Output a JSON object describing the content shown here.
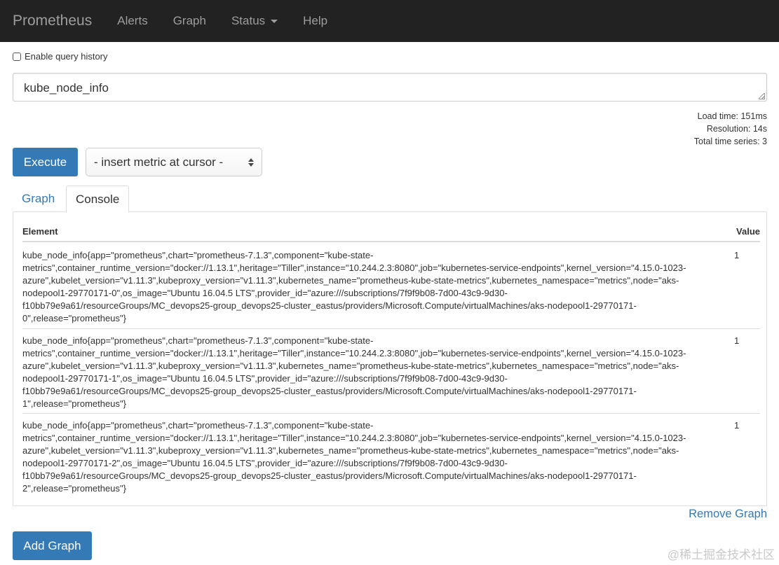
{
  "navbar": {
    "brand": "Prometheus",
    "items": [
      "Alerts",
      "Graph",
      "Status",
      "Help"
    ]
  },
  "history": {
    "label": "Enable query history",
    "checked": false
  },
  "query": {
    "value": "kube_node_info"
  },
  "stats": {
    "load_time": "Load time: 151ms",
    "resolution": "Resolution: 14s",
    "total_series": "Total time series: 3"
  },
  "execute_label": "Execute",
  "metric_select": {
    "selected": "- insert metric at cursor -"
  },
  "tabs": [
    {
      "label": "Graph",
      "active": false
    },
    {
      "label": "Console",
      "active": true
    }
  ],
  "table": {
    "headers": {
      "element": "Element",
      "value": "Value"
    },
    "rows": [
      {
        "element": "kube_node_info{app=\"prometheus\",chart=\"prometheus-7.1.3\",component=\"kube-state-\nmetrics\",container_runtime_version=\"docker://1.13.1\",heritage=\"Tiller\",instance=\"10.244.2.3:8080\",job=\"kubernetes-service-endpoints\",kernel_version=\"4.15.0-1023-\nazure\",kubelet_version=\"v1.11.3\",kubeproxy_version=\"v1.11.3\",kubernetes_name=\"prometheus-kube-state-metrics\",kubernetes_namespace=\"metrics\",node=\"aks-\nnodepool1-29770171-0\",os_image=\"Ubuntu 16.04.5 LTS\",provider_id=\"azure:///subscriptions/7f9f9b08-7d00-43c9-9d30-\nf10bb79e9a61/resourceGroups/MC_devops25-group_devops25-cluster_eastus/providers/Microsoft.Compute/virtualMachines/aks-nodepool1-29770171-\n0\",release=\"prometheus\"}",
        "value": "1"
      },
      {
        "element": "kube_node_info{app=\"prometheus\",chart=\"prometheus-7.1.3\",component=\"kube-state-\nmetrics\",container_runtime_version=\"docker://1.13.1\",heritage=\"Tiller\",instance=\"10.244.2.3:8080\",job=\"kubernetes-service-endpoints\",kernel_version=\"4.15.0-1023-\nazure\",kubelet_version=\"v1.11.3\",kubeproxy_version=\"v1.11.3\",kubernetes_name=\"prometheus-kube-state-metrics\",kubernetes_namespace=\"metrics\",node=\"aks-\nnodepool1-29770171-1\",os_image=\"Ubuntu 16.04.5 LTS\",provider_id=\"azure:///subscriptions/7f9f9b08-7d00-43c9-9d30-\nf10bb79e9a61/resourceGroups/MC_devops25-group_devops25-cluster_eastus/providers/Microsoft.Compute/virtualMachines/aks-nodepool1-29770171-\n1\",release=\"prometheus\"}",
        "value": "1"
      },
      {
        "element": "kube_node_info{app=\"prometheus\",chart=\"prometheus-7.1.3\",component=\"kube-state-\nmetrics\",container_runtime_version=\"docker://1.13.1\",heritage=\"Tiller\",instance=\"10.244.2.3:8080\",job=\"kubernetes-service-endpoints\",kernel_version=\"4.15.0-1023-\nazure\",kubelet_version=\"v1.11.3\",kubeproxy_version=\"v1.11.3\",kubernetes_name=\"prometheus-kube-state-metrics\",kubernetes_namespace=\"metrics\",node=\"aks-\nnodepool1-29770171-2\",os_image=\"Ubuntu 16.04.5 LTS\",provider_id=\"azure:///subscriptions/7f9f9b08-7d00-43c9-9d30-\nf10bb79e9a61/resourceGroups/MC_devops25-group_devops25-cluster_eastus/providers/Microsoft.Compute/virtualMachines/aks-nodepool1-29770171-\n2\",release=\"prometheus\"}",
        "value": "1"
      }
    ]
  },
  "remove_graph_label": "Remove Graph",
  "add_graph_label": "Add Graph",
  "watermark": "@稀土掘金技术社区",
  "colors": {
    "navbar_bg": "#222222",
    "nav_text": "#9d9d9d",
    "primary": "#337ab7",
    "border": "#dddddd"
  }
}
